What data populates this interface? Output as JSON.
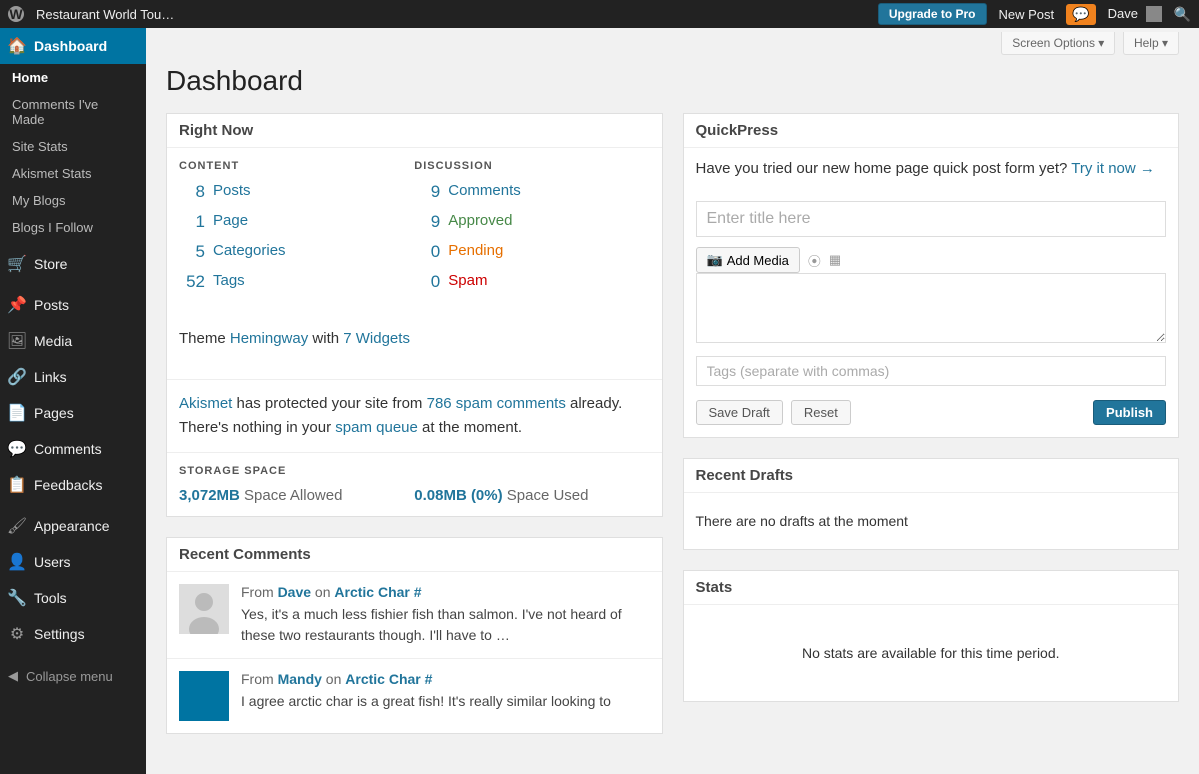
{
  "adminbar": {
    "site_name": "Restaurant World Tou…",
    "upgrade": "Upgrade to Pro",
    "new_post": "New Post",
    "user_name": "Dave"
  },
  "sidebar": {
    "main": [
      {
        "icon": "🏠",
        "label": "Dashboard",
        "current": true
      },
      {
        "icon": "🛒",
        "label": "Store"
      },
      {
        "icon": "📌",
        "label": "Posts"
      },
      {
        "icon": "🖼",
        "label": "Media"
      },
      {
        "icon": "🔗",
        "label": "Links"
      },
      {
        "icon": "📄",
        "label": "Pages"
      },
      {
        "icon": "💬",
        "label": "Comments"
      },
      {
        "icon": "📋",
        "label": "Feedbacks"
      },
      {
        "icon": "🖌",
        "label": "Appearance"
      },
      {
        "icon": "👤",
        "label": "Users"
      },
      {
        "icon": "🔧",
        "label": "Tools"
      },
      {
        "icon": "⚙",
        "label": "Settings"
      }
    ],
    "subs": [
      "Home",
      "Comments I've Made",
      "Site Stats",
      "Akismet Stats",
      "My Blogs",
      "Blogs I Follow"
    ],
    "collapse": "Collapse menu"
  },
  "topOptions": {
    "screen": "Screen Options",
    "help": "Help"
  },
  "page_title": "Dashboard",
  "boxes": {
    "right_now": {
      "title": "Right Now",
      "content_heading": "CONTENT",
      "discussion_heading": "DISCUSSION",
      "content": [
        {
          "n": "8",
          "l": "Posts"
        },
        {
          "n": "1",
          "l": "Page"
        },
        {
          "n": "5",
          "l": "Categories"
        },
        {
          "n": "52",
          "l": "Tags"
        }
      ],
      "discussion": [
        {
          "n": "9",
          "l": "Comments",
          "cls": ""
        },
        {
          "n": "9",
          "l": "Approved",
          "cls": "approved"
        },
        {
          "n": "0",
          "l": "Pending",
          "cls": "pending"
        },
        {
          "n": "0",
          "l": "Spam",
          "cls": "spam"
        }
      ],
      "theme_prefix": "Theme ",
      "theme_name": "Hemingway",
      "theme_mid": " with ",
      "theme_widgets": "7 Widgets",
      "akismet_a": "Akismet",
      "akismet_b": " has protected your site from ",
      "akismet_c": "786 spam comments",
      "akismet_d": " already. There's nothing in your ",
      "akismet_e": "spam queue",
      "akismet_f": " at the moment.",
      "storage_heading": "STORAGE SPACE",
      "storage_allowed_v": "3,072MB",
      "storage_allowed_l": " Space Allowed",
      "storage_used_v": "0.08MB (0%)",
      "storage_used_l": " Space Used"
    },
    "recent_comments": {
      "title": "Recent Comments",
      "items": [
        {
          "from": "From ",
          "author": "Dave",
          "on": " on ",
          "post": "Arctic Char #",
          "text": "Yes, it's a much less fishier fish than salmon. I've not heard of these two restaurants though. I'll have to …",
          "photo": true
        },
        {
          "from": "From ",
          "author": "Mandy",
          "on": " on ",
          "post": "Arctic Char #",
          "text": "I agree arctic char is a great fish! It's really similar looking to",
          "photo": false
        }
      ]
    },
    "quickpress": {
      "title": "QuickPress",
      "promo_a": "Have you tried our new home page quick post form yet? ",
      "promo_b": "Try it now →",
      "title_placeholder": "Enter title here",
      "add_media": "Add Media",
      "tags_placeholder": "Tags (separate with commas)",
      "save_draft": "Save Draft",
      "reset": "Reset",
      "publish": "Publish"
    },
    "recent_drafts": {
      "title": "Recent Drafts",
      "body": "There are no drafts at the moment"
    },
    "stats": {
      "title": "Stats",
      "body": "No stats are available for this time period."
    }
  }
}
